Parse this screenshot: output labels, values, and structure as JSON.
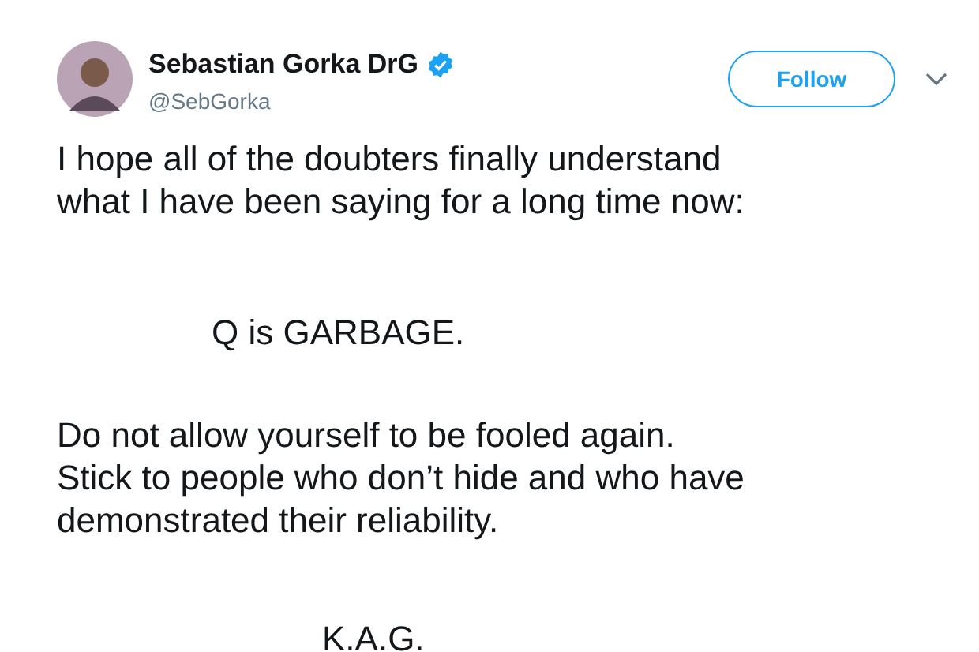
{
  "author": {
    "name": "Sebastian Gorka DrG",
    "handle": "@SebGorka",
    "verified": true
  },
  "follow_button": {
    "label": "Follow"
  },
  "tweet": {
    "paragraphs": [
      {
        "kind": "plain",
        "lines": [
          "I hope all of the doubters finally understand",
          "what I have been saying for a long time now:"
        ]
      },
      {
        "kind": "indent",
        "lines": [
          "Q is GARBAGE."
        ]
      },
      {
        "kind": "plain",
        "lines": [
          "Do not allow yourself to be fooled again.",
          "Stick to people who don’t hide and who have",
          "demonstrated their reliability."
        ]
      },
      {
        "kind": "indent-deep",
        "lines": [
          "K.A.G."
        ]
      }
    ]
  }
}
